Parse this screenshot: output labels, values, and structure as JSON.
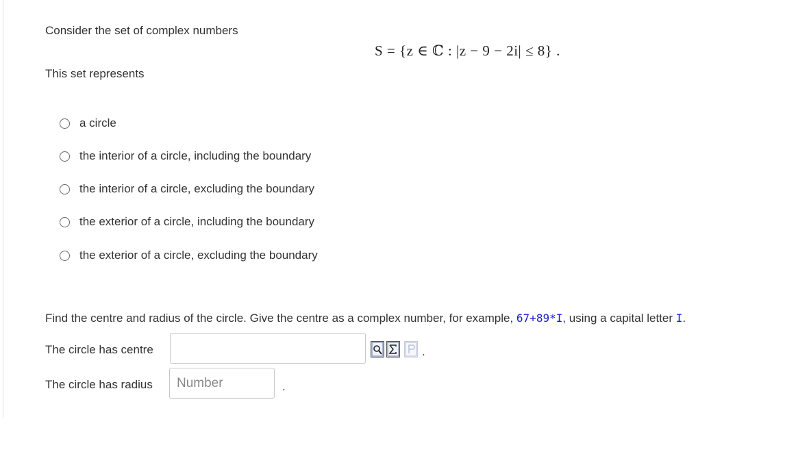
{
  "question": {
    "intro": "Consider the set of complex numbers",
    "set_formula": "S = {z ∈ ℂ : |z − 9 − 2i| ≤ 8} .",
    "represents_label": "This set represents"
  },
  "options": [
    {
      "label": "a circle"
    },
    {
      "label": "the interior of a circle, including the boundary"
    },
    {
      "label": "the interior of a circle, excluding the boundary"
    },
    {
      "label": "the exterior of a circle, including the boundary"
    },
    {
      "label": "the exterior of a circle, excluding the boundary"
    }
  ],
  "part2": {
    "instruction_before": "Find the centre and radius of the circle.  Give the centre as a complex number, for example,",
    "example_code": "67+89*I",
    "instruction_middle": ", using a capital letter",
    "capital_code": "I",
    "instruction_end": "."
  },
  "centre": {
    "label": "The circle has centre",
    "value": "",
    "placeholder": "",
    "icons": [
      "preview-icon",
      "equation-editor-icon",
      "formula-disabled-icon"
    ],
    "trail": "."
  },
  "radius": {
    "label": "The circle has radius",
    "placeholder": "Number",
    "trail": "."
  }
}
